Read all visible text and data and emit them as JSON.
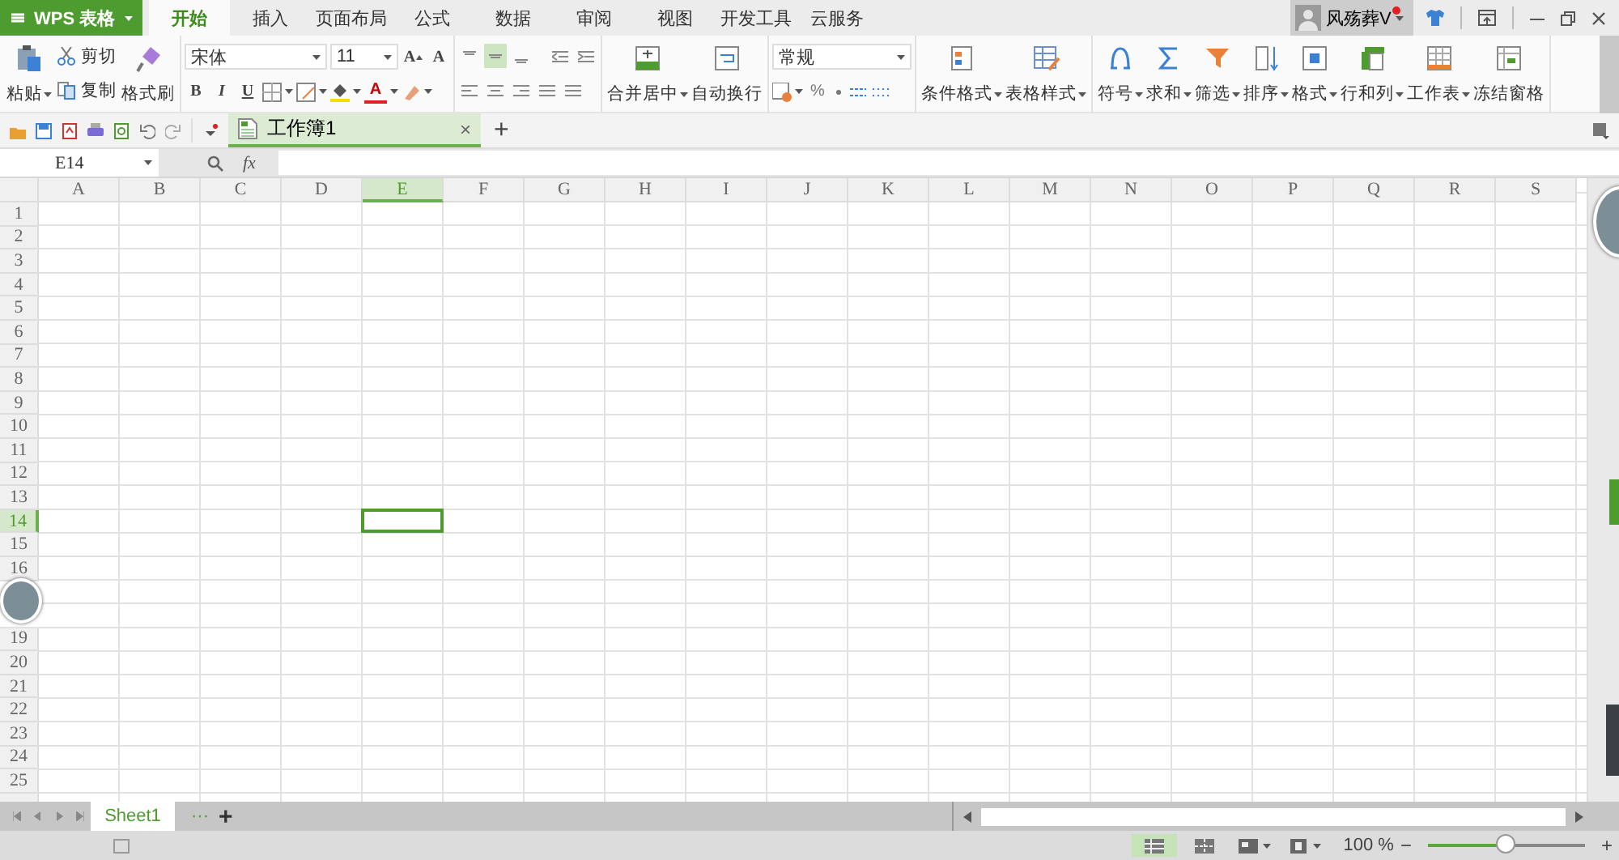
{
  "app_button": {
    "label": "WPS 表格"
  },
  "tabs": [
    {
      "label": "开始",
      "selected": true
    },
    {
      "label": "插入",
      "selected": false
    },
    {
      "label": "页面布局",
      "selected": false
    },
    {
      "label": "公式",
      "selected": false
    },
    {
      "label": "数据",
      "selected": false
    },
    {
      "label": "审阅",
      "selected": false
    },
    {
      "label": "视图",
      "selected": false
    },
    {
      "label": "开发工具",
      "selected": false
    },
    {
      "label": "云服务",
      "selected": false
    }
  ],
  "user": {
    "name": "风殇葬V",
    "notification": true
  },
  "ribbon": [
    {
      "kind": "clipboard",
      "paste": "粘贴",
      "cut": "剪切",
      "copy": "复制",
      "format_painter": "格式刷"
    },
    {
      "kind": "font",
      "font_name": "宋体",
      "font_size": "11",
      "grow": "A",
      "shrink": "A",
      "bold": "B",
      "italic": "I",
      "underline": "U",
      "font_color": "A"
    },
    {
      "kind": "alignment",
      "vertical": [
        {
          "selected": false
        },
        {
          "selected": true
        },
        {
          "selected": false
        }
      ]
    },
    {
      "kind": "large",
      "buttons": [
        {
          "label": "合并居中",
          "dropdown": true
        },
        {
          "label": "自动换行",
          "dropdown": false
        }
      ]
    },
    {
      "kind": "number",
      "format": "常规",
      "percent": "%"
    },
    {
      "kind": "large",
      "buttons": [
        {
          "label": "条件格式",
          "dropdown": true
        },
        {
          "label": "表格样式",
          "dropdown": true
        }
      ]
    },
    {
      "kind": "large",
      "buttons": [
        {
          "label": "符号",
          "dropdown": true
        },
        {
          "label": "求和",
          "dropdown": true
        },
        {
          "label": "筛选",
          "dropdown": true
        },
        {
          "label": "排序",
          "dropdown": true
        },
        {
          "label": "格式",
          "dropdown": true
        },
        {
          "label": "行和列",
          "dropdown": true
        },
        {
          "label": "工作表",
          "dropdown": true
        },
        {
          "label": "冻结窗格",
          "dropdown": false
        }
      ]
    }
  ],
  "document_tabs": [
    {
      "label": "工作簿1",
      "close": "×",
      "selected": true
    }
  ],
  "new_tab": "+",
  "formula_bar": {
    "name_box": "E14",
    "fx": "fx"
  },
  "columns": [
    {
      "label": "A",
      "selected": false
    },
    {
      "label": "B",
      "selected": false
    },
    {
      "label": "C",
      "selected": false
    },
    {
      "label": "D",
      "selected": false
    },
    {
      "label": "E",
      "selected": true
    },
    {
      "label": "F",
      "selected": false
    },
    {
      "label": "G",
      "selected": false
    },
    {
      "label": "H",
      "selected": false
    },
    {
      "label": "I",
      "selected": false
    },
    {
      "label": "J",
      "selected": false
    },
    {
      "label": "K",
      "selected": false
    },
    {
      "label": "L",
      "selected": false
    },
    {
      "label": "M",
      "selected": false
    },
    {
      "label": "N",
      "selected": false
    },
    {
      "label": "O",
      "selected": false
    },
    {
      "label": "P",
      "selected": false
    },
    {
      "label": "Q",
      "selected": false
    },
    {
      "label": "R",
      "selected": false
    },
    {
      "label": "S",
      "selected": false
    }
  ],
  "rows": [
    {
      "label": "1",
      "selected": false
    },
    {
      "label": "2",
      "selected": false
    },
    {
      "label": "3",
      "selected": false
    },
    {
      "label": "4",
      "selected": false
    },
    {
      "label": "5",
      "selected": false
    },
    {
      "label": "6",
      "selected": false
    },
    {
      "label": "7",
      "selected": false
    },
    {
      "label": "8",
      "selected": false
    },
    {
      "label": "9",
      "selected": false
    },
    {
      "label": "10",
      "selected": false
    },
    {
      "label": "11",
      "selected": false
    },
    {
      "label": "12",
      "selected": false
    },
    {
      "label": "13",
      "selected": false
    },
    {
      "label": "14",
      "selected": true
    },
    {
      "label": "15",
      "selected": false
    },
    {
      "label": "16",
      "selected": false
    },
    {
      "covered": true,
      "selected": false
    },
    {
      "covered": true,
      "selected": false
    },
    {
      "label": "19",
      "selected": false
    },
    {
      "label": "20",
      "selected": false
    },
    {
      "label": "21",
      "selected": false
    },
    {
      "label": "22",
      "selected": false
    },
    {
      "label": "23",
      "selected": false
    },
    {
      "label": "24",
      "selected": false
    },
    {
      "label": "25",
      "selected": false
    }
  ],
  "sheet_tabs": [
    {
      "label": "Sheet1",
      "selected": true
    }
  ],
  "sheet_more": "···",
  "sheet_add": "+",
  "status_bar": {
    "views": [
      {
        "selected": true
      },
      {
        "selected": false
      },
      {
        "selected": false
      },
      {
        "selected": false
      }
    ],
    "zoom": "100 %",
    "zoom_out": "−",
    "zoom_in": "+",
    "level": 0.49
  }
}
